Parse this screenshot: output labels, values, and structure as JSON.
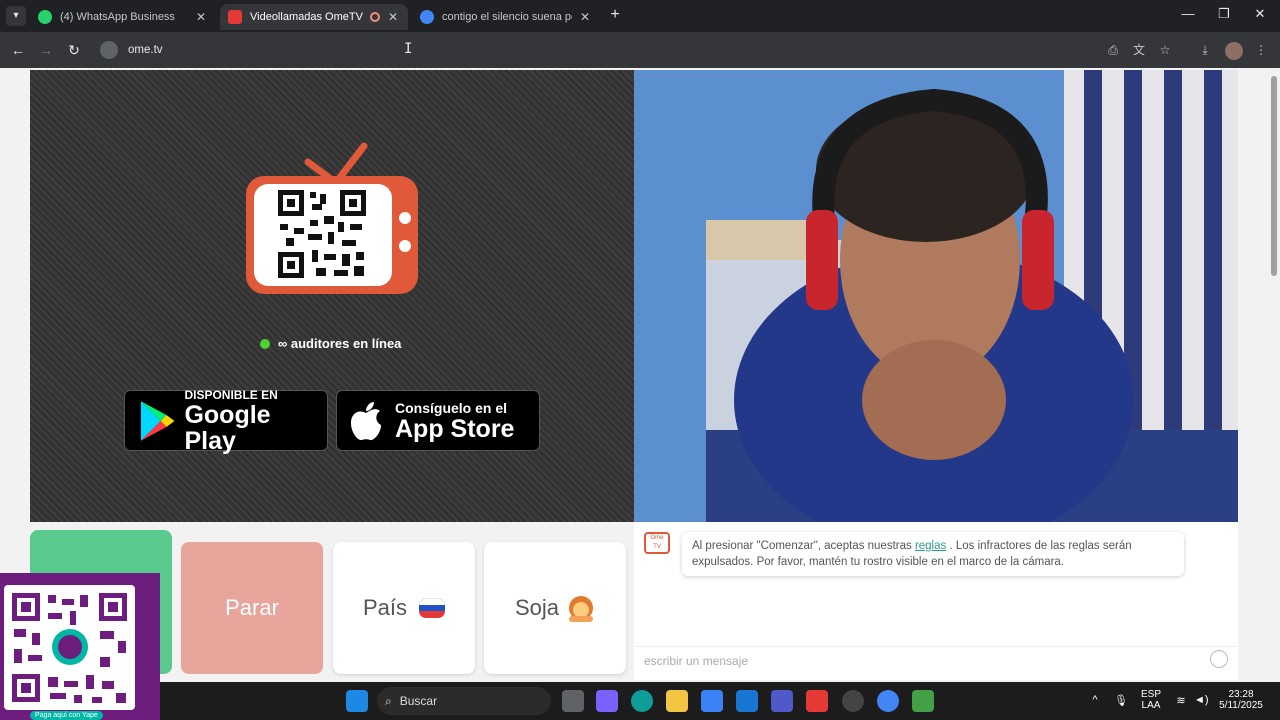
{
  "tabs": [
    {
      "title": "(4) WhatsApp Business",
      "favicon_color": "#25d366",
      "active": false
    },
    {
      "title": "Videollamadas OmeTV — A",
      "favicon_color": "#e53935",
      "active": true
    },
    {
      "title": "contigo el silencio suena perfe",
      "favicon_color": "#4285f4",
      "active": false
    }
  ],
  "toolbar": {
    "url": "ome.tv"
  },
  "promo": {
    "online_text": "∞ auditores en línea",
    "google_small": "DISPONIBLE EN",
    "google_big": "Google Play",
    "apple_small": "Consíguelo en el",
    "apple_big": "App Store"
  },
  "controls": {
    "stop_label": "Parar",
    "country_label": "País",
    "gender_label": "Soja"
  },
  "chat": {
    "logo_text": "Ome TV",
    "notice_before": "Al presionar \"Comenzar\", aceptas nuestras ",
    "notice_link": "reglas",
    "notice_after": " . Los infractores de las reglas serán expulsados. Por favor, mantén tu rostro visible en el marco de la cámara.",
    "input_placeholder": "escribir un mensaje"
  },
  "yape": {
    "caption": "Paga aquí con Yape"
  },
  "taskbar": {
    "search_label": "Buscar",
    "lang_top": "ESP",
    "lang_bottom": "LAA",
    "time": "23:28",
    "date": "5/11/2025"
  },
  "colors": {
    "accent": "#e05a3a",
    "start": "#5ac98e",
    "stop": "#e8a59b",
    "online": "#4cd137"
  }
}
